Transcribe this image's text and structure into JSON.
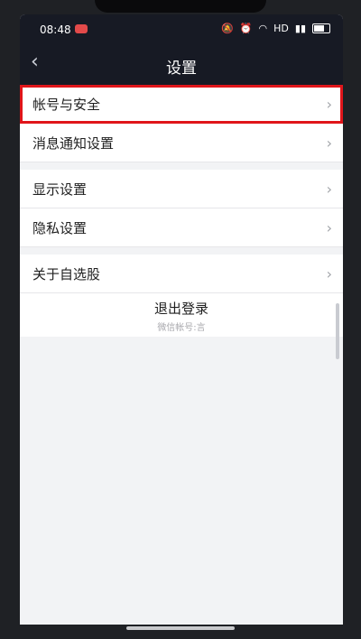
{
  "status_bar": {
    "time": "08:48",
    "signal_text": "HD"
  },
  "nav": {
    "title": "设置",
    "back_icon": "chevron-left-icon"
  },
  "settings": [
    {
      "label": "帐号与安全",
      "highlighted": true
    },
    {
      "label": "消息通知设置"
    },
    {
      "label": "显示设置"
    },
    {
      "label": "隐私设置"
    },
    {
      "label": "关于自选股"
    }
  ],
  "logout": {
    "label": "退出登录",
    "account": "微信帐号:言"
  },
  "colors": {
    "header": "#171a24",
    "highlight": "#e0151a",
    "background": "#f2f3f5"
  }
}
